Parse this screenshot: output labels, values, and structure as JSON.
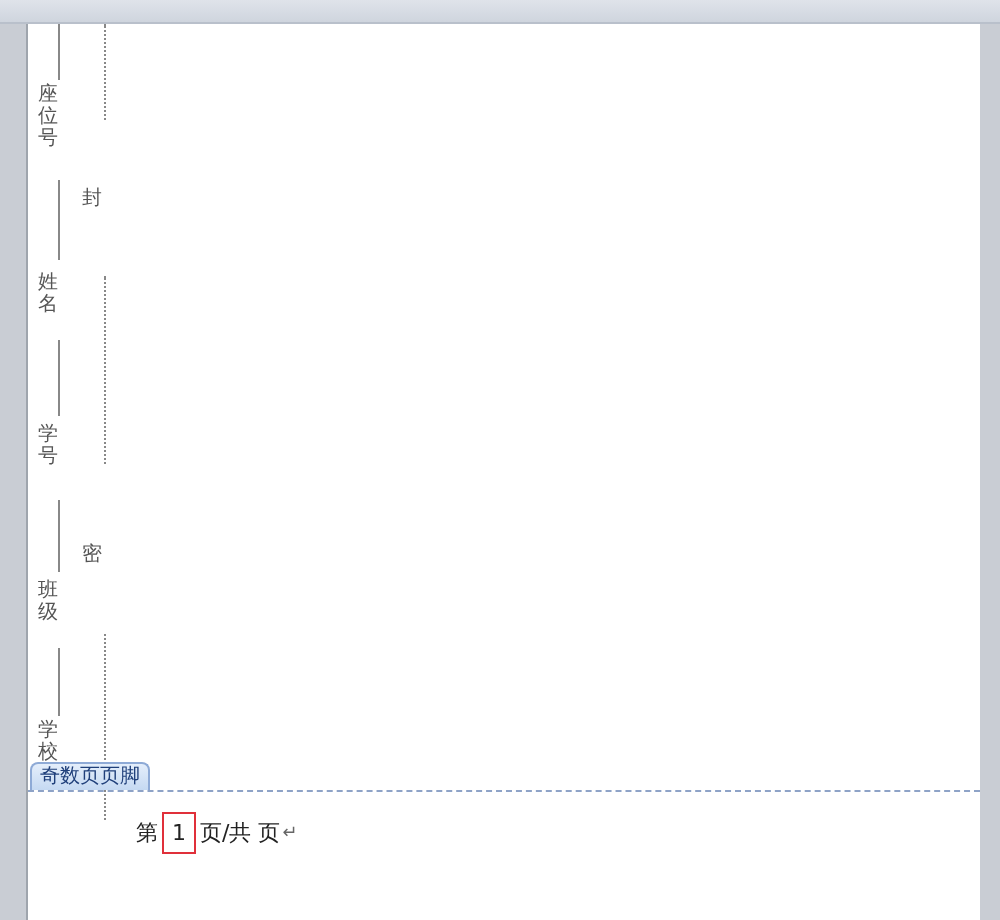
{
  "binding_margin": {
    "fields": [
      "座位号",
      "姓名",
      "学号",
      "班级",
      "学校"
    ],
    "seal_marks": [
      "封",
      "密"
    ]
  },
  "footer": {
    "tab_label": "奇数页页脚",
    "prefix": "第",
    "field_value": "1",
    "suffix": "页/共 页",
    "paragraph_mark": "↵"
  }
}
